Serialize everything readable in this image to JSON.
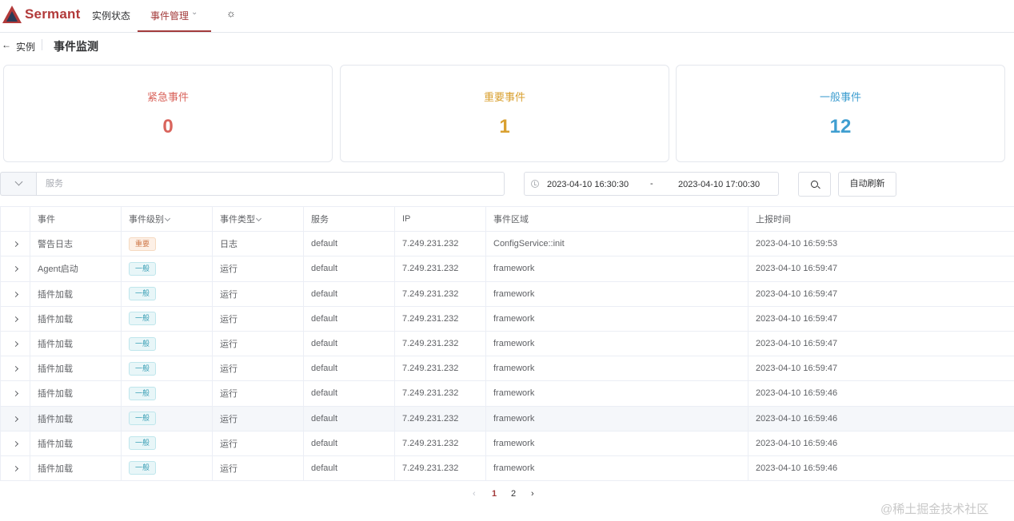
{
  "header": {
    "brand": "Sermant",
    "nav": {
      "instance": "实例状态",
      "events": "事件管理"
    }
  },
  "page": {
    "back_label": "实例",
    "title": "事件监测"
  },
  "stats": {
    "urgent": {
      "label": "紧急事件",
      "value": "0",
      "color": "#d9645c"
    },
    "important": {
      "label": "重要事件",
      "value": "1",
      "color": "#d9a030"
    },
    "general": {
      "label": "一般事件",
      "value": "12",
      "color": "#3f9ed0"
    }
  },
  "filters": {
    "service_placeholder": "服务",
    "date_start": "2023-04-10 16:30:30",
    "date_separator": "-",
    "date_end": "2023-04-10 17:00:30",
    "refresh_label": "自动刷新"
  },
  "table": {
    "columns": [
      "事件",
      "事件级别",
      "事件类型",
      "服务",
      "IP",
      "事件区域",
      "上报时间"
    ],
    "rows": [
      {
        "event": "警告日志",
        "level": "重要",
        "type": "日志",
        "service": "default",
        "ip": "7.249.231.232",
        "area": "ConfigService::init",
        "time": "2023-04-10 16:59:53"
      },
      {
        "event": "Agent启动",
        "level": "一般",
        "type": "运行",
        "service": "default",
        "ip": "7.249.231.232",
        "area": "framework",
        "time": "2023-04-10 16:59:47"
      },
      {
        "event": "插件加载",
        "level": "一般",
        "type": "运行",
        "service": "default",
        "ip": "7.249.231.232",
        "area": "framework",
        "time": "2023-04-10 16:59:47"
      },
      {
        "event": "插件加载",
        "level": "一般",
        "type": "运行",
        "service": "default",
        "ip": "7.249.231.232",
        "area": "framework",
        "time": "2023-04-10 16:59:47"
      },
      {
        "event": "插件加载",
        "level": "一般",
        "type": "运行",
        "service": "default",
        "ip": "7.249.231.232",
        "area": "framework",
        "time": "2023-04-10 16:59:47"
      },
      {
        "event": "插件加载",
        "level": "一般",
        "type": "运行",
        "service": "default",
        "ip": "7.249.231.232",
        "area": "framework",
        "time": "2023-04-10 16:59:47"
      },
      {
        "event": "插件加载",
        "level": "一般",
        "type": "运行",
        "service": "default",
        "ip": "7.249.231.232",
        "area": "framework",
        "time": "2023-04-10 16:59:46"
      },
      {
        "event": "插件加载",
        "level": "一般",
        "type": "运行",
        "service": "default",
        "ip": "7.249.231.232",
        "area": "framework",
        "time": "2023-04-10 16:59:46"
      },
      {
        "event": "插件加载",
        "level": "一般",
        "type": "运行",
        "service": "default",
        "ip": "7.249.231.232",
        "area": "framework",
        "time": "2023-04-10 16:59:46"
      },
      {
        "event": "插件加载",
        "level": "一般",
        "type": "运行",
        "service": "default",
        "ip": "7.249.231.232",
        "area": "framework",
        "time": "2023-04-10 16:59:46"
      }
    ]
  },
  "pagination": {
    "prev": "‹",
    "pages": [
      "1",
      "2"
    ],
    "next": "›",
    "current": "1"
  },
  "watermark": "@稀土掘金技术社区"
}
